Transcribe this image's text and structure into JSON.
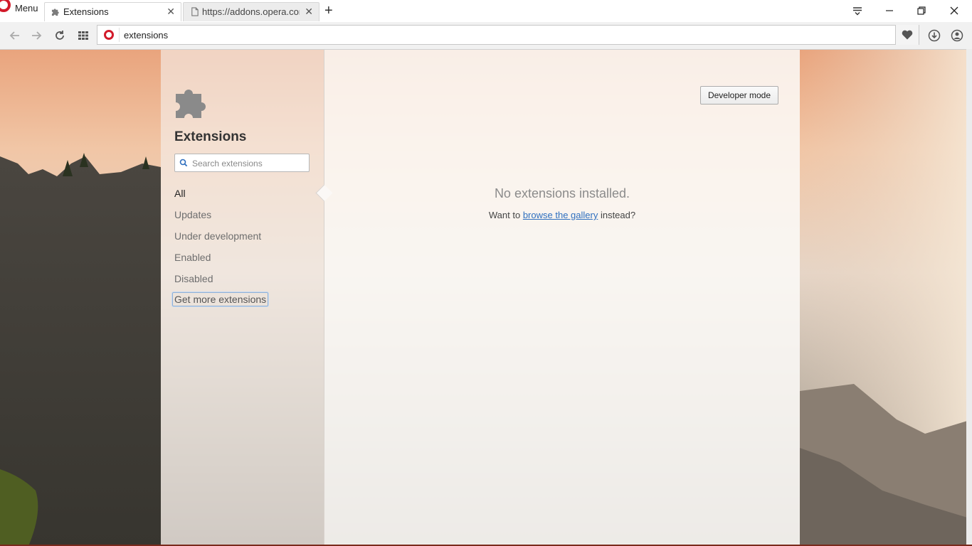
{
  "browser": {
    "menu_label": "Menu",
    "tabs": [
      {
        "title": "Extensions",
        "icon": "puzzle-icon",
        "active": true
      },
      {
        "title": "https://addons.opera.com",
        "icon": "page-icon",
        "active": false
      }
    ],
    "address": {
      "value": "extensions"
    },
    "colors": {
      "brand": "#d21a2a",
      "link": "#2f6fbf"
    }
  },
  "sidebar": {
    "title": "Extensions",
    "search_placeholder": "Search extensions",
    "items": [
      {
        "label": "All"
      },
      {
        "label": "Updates"
      },
      {
        "label": "Under development"
      },
      {
        "label": "Enabled"
      },
      {
        "label": "Disabled"
      },
      {
        "label": "Get more extensions"
      }
    ]
  },
  "main": {
    "developer_mode_label": "Developer mode",
    "empty_title": "No extensions installed.",
    "empty_prefix": "Want to",
    "empty_link": "browse the gallery",
    "empty_suffix": "instead?"
  }
}
